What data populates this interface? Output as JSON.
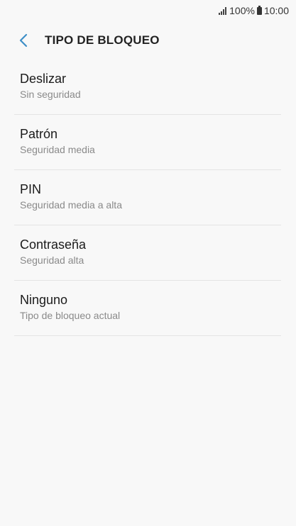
{
  "status_bar": {
    "battery": "100%",
    "time": "10:00"
  },
  "header": {
    "title": "TIPO DE BLOQUEO",
    "back_icon": "chevron-left-icon",
    "accent": "#3e8fc7"
  },
  "lock_types": [
    {
      "title": "Deslizar",
      "subtitle": "Sin seguridad"
    },
    {
      "title": "Patrón",
      "subtitle": "Seguridad media"
    },
    {
      "title": "PIN",
      "subtitle": "Seguridad media a alta"
    },
    {
      "title": "Contraseña",
      "subtitle": "Seguridad alta"
    },
    {
      "title": "Ninguno",
      "subtitle": "Tipo de bloqueo actual"
    }
  ]
}
